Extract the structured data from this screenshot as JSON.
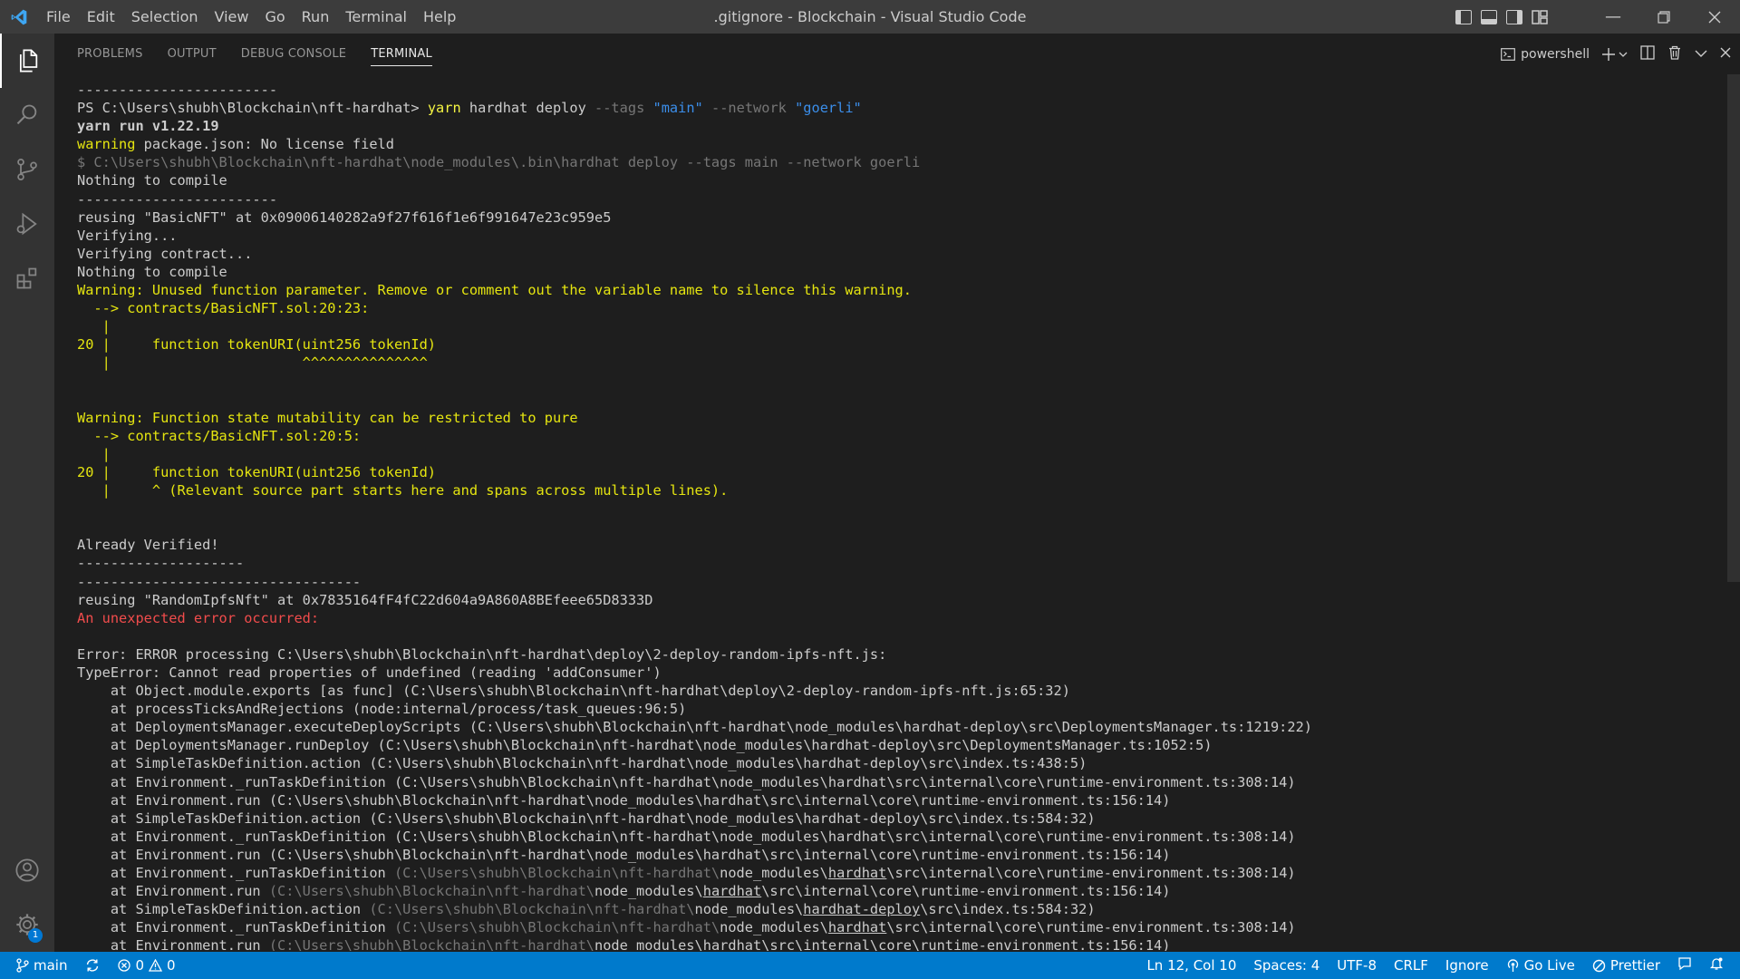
{
  "window": {
    "title": ".gitignore - Blockchain - Visual Studio Code",
    "menu": [
      "File",
      "Edit",
      "Selection",
      "View",
      "Go",
      "Run",
      "Terminal",
      "Help"
    ]
  },
  "panel": {
    "tabs": [
      "PROBLEMS",
      "OUTPUT",
      "DEBUG CONSOLE",
      "TERMINAL"
    ],
    "active_tab": "TERMINAL",
    "terminal_profile": "powershell"
  },
  "terminal": {
    "lines": [
      {
        "text": "------------------------",
        "cls": ""
      },
      {
        "text": "",
        "cls": "",
        "parts": [
          {
            "t": "PS C:\\Users\\shubh\\Blockchain\\nft-hardhat> ",
            "c": ""
          },
          {
            "t": "yarn",
            "c": "yb"
          },
          {
            "t": " hardhat deploy ",
            "c": ""
          },
          {
            "t": "--tags",
            "c": "dim"
          },
          {
            "t": " ",
            "c": ""
          },
          {
            "t": "\"main\"",
            "c": "str"
          },
          {
            "t": " ",
            "c": ""
          },
          {
            "t": "--network",
            "c": "dim"
          },
          {
            "t": " ",
            "c": ""
          },
          {
            "t": "\"goerli\"",
            "c": "str"
          }
        ]
      },
      {
        "text": "yarn run v1.22.19",
        "cls": "bold"
      },
      {
        "text": "",
        "cls": "",
        "parts": [
          {
            "t": "warning",
            "c": "y"
          },
          {
            "t": " package.json: No license field",
            "c": ""
          }
        ]
      },
      {
        "text": "$ C:\\Users\\shubh\\Blockchain\\nft-hardhat\\node_modules\\.bin\\hardhat deploy --tags main --network goerli",
        "cls": "dim"
      },
      {
        "text": "Nothing to compile",
        "cls": ""
      },
      {
        "text": "------------------------",
        "cls": ""
      },
      {
        "text": "reusing \"BasicNFT\" at 0x09006140282a9f27f616f1e6f991647e23c959e5",
        "cls": ""
      },
      {
        "text": "Verifying...",
        "cls": ""
      },
      {
        "text": "Verifying contract...",
        "cls": ""
      },
      {
        "text": "Nothing to compile",
        "cls": ""
      },
      {
        "text": "Warning: Unused function parameter. Remove or comment out the variable name to silence this warning.",
        "cls": "y"
      },
      {
        "text": "  --> contracts/BasicNFT.sol:20:23:",
        "cls": "y"
      },
      {
        "text": "   |",
        "cls": "y"
      },
      {
        "text": "20 |     function tokenURI(uint256 tokenId)",
        "cls": "y"
      },
      {
        "text": "   |                       ^^^^^^^^^^^^^^^",
        "cls": "y"
      },
      {
        "text": "",
        "cls": ""
      },
      {
        "text": "",
        "cls": ""
      },
      {
        "text": "Warning: Function state mutability can be restricted to pure",
        "cls": "y"
      },
      {
        "text": "  --> contracts/BasicNFT.sol:20:5:",
        "cls": "y"
      },
      {
        "text": "   |",
        "cls": "y"
      },
      {
        "text": "20 |     function tokenURI(uint256 tokenId)",
        "cls": "y"
      },
      {
        "text": "   |     ^ (Relevant source part starts here and spans across multiple lines).",
        "cls": "y"
      },
      {
        "text": "",
        "cls": ""
      },
      {
        "text": "",
        "cls": ""
      },
      {
        "text": "Already Verified!",
        "cls": ""
      },
      {
        "text": "--------------------",
        "cls": ""
      },
      {
        "text": "----------------------------------",
        "cls": ""
      },
      {
        "text": "reusing \"RandomIpfsNft\" at 0x7835164fF4fC22d604a9A860A8BEfeee65D8333D",
        "cls": ""
      },
      {
        "text": "An unexpected error occurred:",
        "cls": "r"
      },
      {
        "text": "",
        "cls": ""
      },
      {
        "text": "Error: ERROR processing C:\\Users\\shubh\\Blockchain\\nft-hardhat\\deploy\\2-deploy-random-ipfs-nft.js:",
        "cls": ""
      },
      {
        "text": "TypeError: Cannot read properties of undefined (reading 'addConsumer')",
        "cls": ""
      },
      {
        "text": "    at Object.module.exports [as func] (C:\\Users\\shubh\\Blockchain\\nft-hardhat\\deploy\\2-deploy-random-ipfs-nft.js:65:32)",
        "cls": ""
      },
      {
        "text": "    at processTicksAndRejections (node:internal/process/task_queues:96:5)",
        "cls": ""
      },
      {
        "text": "    at DeploymentsManager.executeDeployScripts (C:\\Users\\shubh\\Blockchain\\nft-hardhat\\node_modules\\hardhat-deploy\\src\\DeploymentsManager.ts:1219:22)",
        "cls": ""
      },
      {
        "text": "    at DeploymentsManager.runDeploy (C:\\Users\\shubh\\Blockchain\\nft-hardhat\\node_modules\\hardhat-deploy\\src\\DeploymentsManager.ts:1052:5)",
        "cls": ""
      },
      {
        "text": "    at SimpleTaskDefinition.action (C:\\Users\\shubh\\Blockchain\\nft-hardhat\\node_modules\\hardhat-deploy\\src\\index.ts:438:5)",
        "cls": ""
      },
      {
        "text": "    at Environment._runTaskDefinition (C:\\Users\\shubh\\Blockchain\\nft-hardhat\\node_modules\\hardhat\\src\\internal\\core\\runtime-environment.ts:308:14)",
        "cls": ""
      },
      {
        "text": "    at Environment.run (C:\\Users\\shubh\\Blockchain\\nft-hardhat\\node_modules\\hardhat\\src\\internal\\core\\runtime-environment.ts:156:14)",
        "cls": ""
      },
      {
        "text": "    at SimpleTaskDefinition.action (C:\\Users\\shubh\\Blockchain\\nft-hardhat\\node_modules\\hardhat-deploy\\src\\index.ts:584:32)",
        "cls": ""
      },
      {
        "text": "    at Environment._runTaskDefinition (C:\\Users\\shubh\\Blockchain\\nft-hardhat\\node_modules\\hardhat\\src\\internal\\core\\runtime-environment.ts:308:14)",
        "cls": ""
      },
      {
        "text": "    at Environment.run (C:\\Users\\shubh\\Blockchain\\nft-hardhat\\node_modules\\hardhat\\src\\internal\\core\\runtime-environment.ts:156:14)",
        "cls": ""
      },
      {
        "text": "",
        "cls": "",
        "parts": [
          {
            "t": "    at Environment._runTaskDefinition ",
            "c": ""
          },
          {
            "t": "(C:\\Users\\shubh\\Blockchain\\nft-hardhat\\",
            "c": "dim"
          },
          {
            "t": "node_modules\\",
            "c": ""
          },
          {
            "t": "hardhat",
            "c": "u"
          },
          {
            "t": "\\src\\internal\\core\\runtime-environment.ts:308:14)",
            "c": ""
          }
        ]
      },
      {
        "text": "",
        "cls": "",
        "parts": [
          {
            "t": "    at Environment.run ",
            "c": ""
          },
          {
            "t": "(C:\\Users\\shubh\\Blockchain\\nft-hardhat\\",
            "c": "dim"
          },
          {
            "t": "node_modules\\",
            "c": ""
          },
          {
            "t": "hardhat",
            "c": "u"
          },
          {
            "t": "\\src\\internal\\core\\runtime-environment.ts:156:14)",
            "c": ""
          }
        ]
      },
      {
        "text": "",
        "cls": "",
        "parts": [
          {
            "t": "    at SimpleTaskDefinition.action ",
            "c": ""
          },
          {
            "t": "(C:\\Users\\shubh\\Blockchain\\nft-hardhat\\",
            "c": "dim"
          },
          {
            "t": "node_modules\\",
            "c": ""
          },
          {
            "t": "hardhat-deploy",
            "c": "u"
          },
          {
            "t": "\\src\\index.ts:584:32)",
            "c": ""
          }
        ]
      },
      {
        "text": "",
        "cls": "",
        "parts": [
          {
            "t": "    at Environment._runTaskDefinition ",
            "c": ""
          },
          {
            "t": "(C:\\Users\\shubh\\Blockchain\\nft-hardhat\\",
            "c": "dim"
          },
          {
            "t": "node_modules\\",
            "c": ""
          },
          {
            "t": "hardhat",
            "c": "u"
          },
          {
            "t": "\\src\\internal\\core\\runtime-environment.ts:308:14)",
            "c": ""
          }
        ]
      },
      {
        "text": "",
        "cls": "",
        "parts": [
          {
            "t": "    at Environment.run ",
            "c": ""
          },
          {
            "t": "(C:\\Users\\shubh\\Blockchain\\nft-hardhat\\",
            "c": "dim"
          },
          {
            "t": "node_modules\\",
            "c": ""
          },
          {
            "t": "hardhat",
            "c": "u"
          },
          {
            "t": "\\src\\internal\\core\\runtime-environment.ts:156:14)",
            "c": ""
          }
        ]
      }
    ]
  },
  "statusbar": {
    "branch": "main",
    "errors": "0",
    "warnings": "0",
    "position": "Ln 12, Col 10",
    "spaces": "Spaces: 4",
    "encoding": "UTF-8",
    "eol": "CRLF",
    "language": "Ignore",
    "golive": "Go Live",
    "prettier": "Prettier"
  },
  "activitybar": {
    "settings_badge": "1"
  },
  "colors": {
    "accent": "#007acc",
    "warning_text": "#e5e510",
    "error_text": "#f14c4c",
    "string": "#3b8eea"
  }
}
